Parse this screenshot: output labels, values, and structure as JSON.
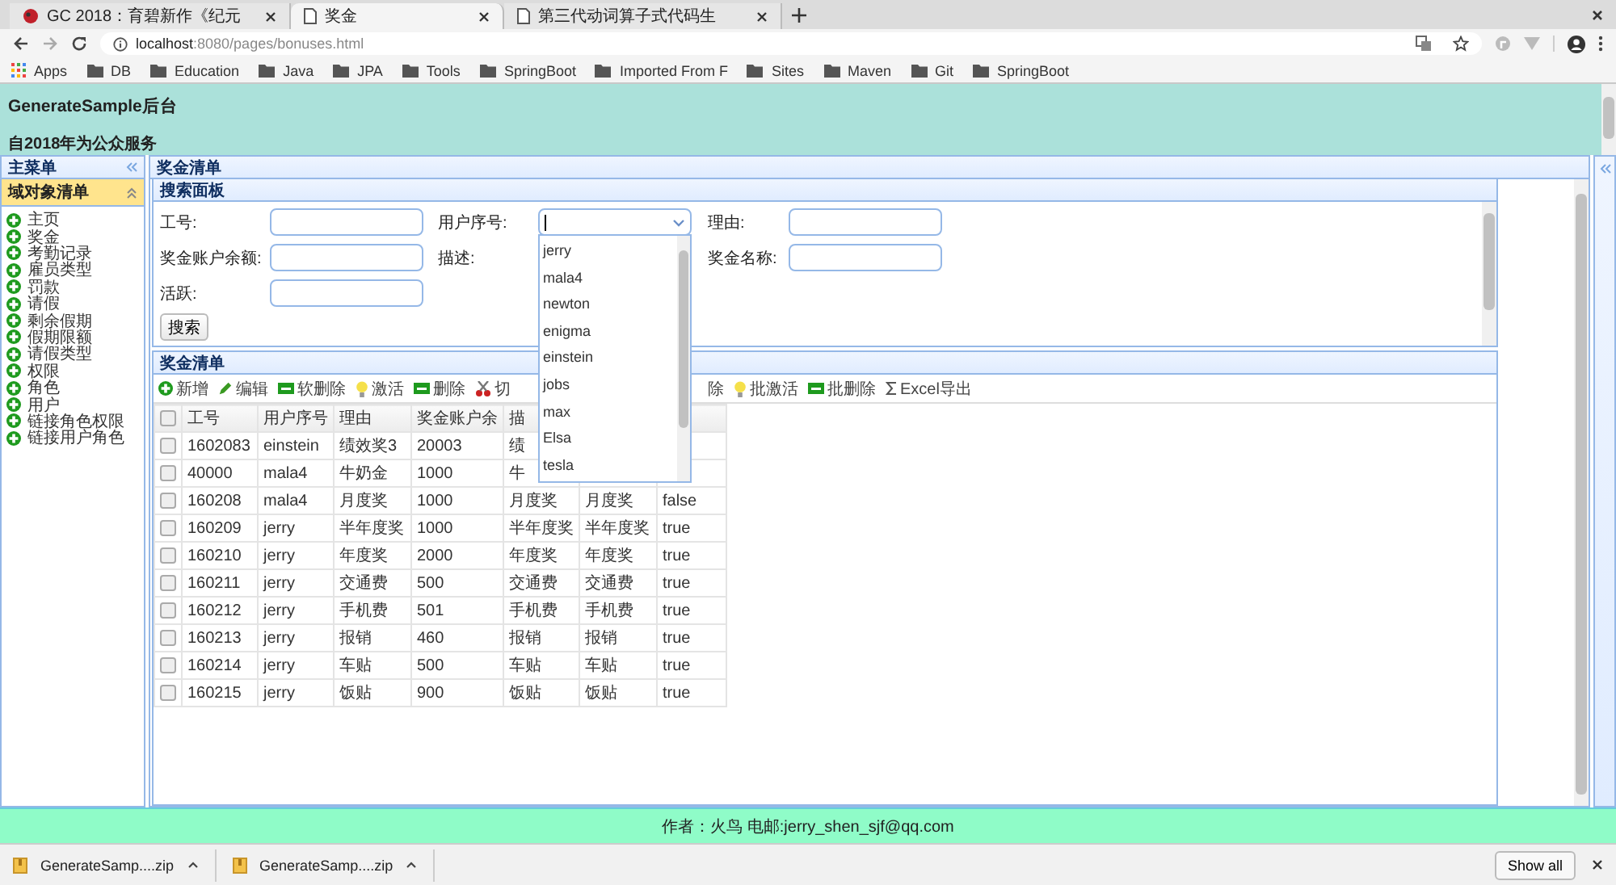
{
  "browser": {
    "tabs": [
      {
        "title": "GC 2018：育碧新作《纪元",
        "kind": "favicon",
        "selected": false
      },
      {
        "title": "奖金",
        "kind": "page",
        "selected": true
      },
      {
        "title": "第三代动词算子式代码生",
        "kind": "page",
        "selected": false
      }
    ],
    "address": {
      "host": "localhost",
      "path": ":8080/pages/bonuses.html"
    },
    "bookmarks": [
      {
        "label": "Apps",
        "kind": "apps"
      },
      {
        "label": "DB",
        "kind": "folder"
      },
      {
        "label": "Education",
        "kind": "folder"
      },
      {
        "label": "Java",
        "kind": "folder"
      },
      {
        "label": "JPA",
        "kind": "folder"
      },
      {
        "label": "Tools",
        "kind": "folder"
      },
      {
        "label": "SpringBoot",
        "kind": "folder"
      },
      {
        "label": "Imported From F",
        "kind": "folder"
      },
      {
        "label": "Sites",
        "kind": "folder"
      },
      {
        "label": "Maven",
        "kind": "folder"
      },
      {
        "label": "Git",
        "kind": "folder"
      },
      {
        "label": "SpringBoot",
        "kind": "folder"
      }
    ]
  },
  "header": {
    "title": "GenerateSample后台",
    "subtitle": "自2018年为公众服务"
  },
  "sidebar": {
    "title": "主菜单",
    "section": {
      "title": "域对象清单",
      "selected": true
    },
    "items": [
      "主页",
      "奖金",
      "考勤记录",
      "雇员类型",
      "罚款",
      "请假",
      "剩余假期",
      "假期限额",
      "请假类型",
      "权限",
      "角色",
      "用户",
      "链接角色权限",
      "链接用户角色"
    ]
  },
  "main": {
    "title": "奖金清单",
    "search_panel": {
      "title": "搜索面板",
      "rows": [
        [
          {
            "label": "工号:",
            "kind": "text"
          },
          {
            "label": "用户序号:",
            "kind": "combo"
          },
          {
            "label": "理由:",
            "kind": "text"
          }
        ],
        [
          {
            "label": "奖金账户余额:",
            "kind": "text"
          },
          {
            "label": "描述:",
            "kind": "label"
          },
          {
            "label": "奖金名称:",
            "kind": "text"
          }
        ],
        [
          {
            "label": "活跃:",
            "kind": "text"
          }
        ]
      ],
      "search_button": "搜索",
      "dropdown": {
        "options": [
          "jerry",
          "mala4",
          "newton",
          "enigma",
          "einstein",
          "jobs",
          "max",
          "Elsa",
          "tesla"
        ]
      }
    },
    "grid": {
      "title": "奖金清单",
      "toolbar_left": [
        {
          "label": "新增",
          "kind": "add"
        },
        {
          "label": "编辑",
          "kind": "edit"
        },
        {
          "label": "软删除",
          "kind": "minus"
        },
        {
          "label": "激活",
          "kind": "bulb"
        },
        {
          "label": "删除",
          "kind": "minus"
        },
        {
          "label": "切",
          "kind": "cut"
        }
      ],
      "toolbar_right": [
        {
          "label": "除",
          "kind": "plain"
        },
        {
          "label": "批激活",
          "kind": "bulb"
        },
        {
          "label": "批删除",
          "kind": "minus"
        },
        {
          "label": "Excel导出",
          "kind": "sigma"
        }
      ],
      "header_checked": false,
      "columns": [
        "工号",
        "用户序号",
        "理由",
        "奖金账户余",
        "描"
      ],
      "rows": [
        {
          "checked": false,
          "cells": [
            "1602083",
            "einstein",
            "绩效奖3",
            "20003",
            "绩"
          ]
        },
        {
          "checked": false,
          "cells": [
            "40000",
            "mala4",
            "牛奶金",
            "1000",
            "牛"
          ]
        },
        {
          "checked": false,
          "cells": [
            "160208",
            "mala4",
            "月度奖",
            "1000",
            "月度奖",
            "月度奖",
            "false"
          ]
        },
        {
          "checked": false,
          "cells": [
            "160209",
            "jerry",
            "半年度奖",
            "1000",
            "半年度奖",
            "半年度奖",
            "true"
          ]
        },
        {
          "checked": false,
          "cells": [
            "160210",
            "jerry",
            "年度奖",
            "2000",
            "年度奖",
            "年度奖",
            "true"
          ]
        },
        {
          "checked": false,
          "cells": [
            "160211",
            "jerry",
            "交通费",
            "500",
            "交通费",
            "交通费",
            "true"
          ]
        },
        {
          "checked": false,
          "cells": [
            "160212",
            "jerry",
            "手机费",
            "501",
            "手机费",
            "手机费",
            "true"
          ]
        },
        {
          "checked": false,
          "cells": [
            "160213",
            "jerry",
            "报销",
            "460",
            "报销",
            "报销",
            "true"
          ]
        },
        {
          "checked": false,
          "cells": [
            "160214",
            "jerry",
            "车贴",
            "500",
            "车贴",
            "车贴",
            "true"
          ]
        },
        {
          "checked": false,
          "cells": [
            "160215",
            "jerry",
            "饭贴",
            "900",
            "饭贴",
            "饭贴",
            "true"
          ]
        }
      ]
    }
  },
  "footer": "作者：火鸟 电邮:jerry_shen_sjf@qq.com",
  "downloads": {
    "items": [
      "GenerateSamp....zip",
      "GenerateSamp....zip"
    ],
    "show_all": "Show all"
  }
}
